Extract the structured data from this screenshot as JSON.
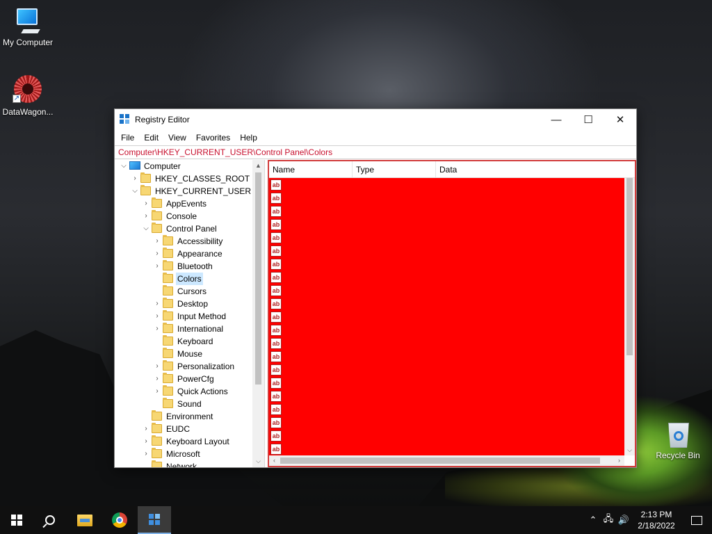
{
  "desktop": {
    "icons": [
      {
        "label": "My Computer"
      },
      {
        "label": "DataWagon..."
      },
      {
        "label": "Recycle Bin"
      }
    ]
  },
  "window": {
    "title": "Registry Editor",
    "controls": {
      "minimize": "—",
      "maximize": "☐",
      "close": "✕"
    },
    "menu": [
      "File",
      "Edit",
      "View",
      "Favorites",
      "Help"
    ],
    "address": "Computer\\HKEY_CURRENT_USER\\Control Panel\\Colors",
    "tree": [
      {
        "label": "Computer",
        "expander": "⌵"
      },
      {
        "label": "HKEY_CLASSES_ROOT",
        "expander": "›"
      },
      {
        "label": "HKEY_CURRENT_USER",
        "expander": "⌵"
      },
      {
        "label": "AppEvents",
        "expander": "›"
      },
      {
        "label": "Console",
        "expander": "›"
      },
      {
        "label": "Control Panel",
        "expander": "⌵"
      },
      {
        "label": "Accessibility",
        "expander": "›"
      },
      {
        "label": "Appearance",
        "expander": "›"
      },
      {
        "label": "Bluetooth",
        "expander": "›"
      },
      {
        "label": "Colors",
        "expander": ""
      },
      {
        "label": "Cursors",
        "expander": ""
      },
      {
        "label": "Desktop",
        "expander": "›"
      },
      {
        "label": "Input Method",
        "expander": "›"
      },
      {
        "label": "International",
        "expander": "›"
      },
      {
        "label": "Keyboard",
        "expander": ""
      },
      {
        "label": "Mouse",
        "expander": ""
      },
      {
        "label": "Personalization",
        "expander": "›"
      },
      {
        "label": "PowerCfg",
        "expander": "›"
      },
      {
        "label": "Quick Actions",
        "expander": "›"
      },
      {
        "label": "Sound",
        "expander": ""
      },
      {
        "label": "Environment",
        "expander": ""
      },
      {
        "label": "EUDC",
        "expander": "›"
      },
      {
        "label": "Keyboard Layout",
        "expander": "›"
      },
      {
        "label": "Microsoft",
        "expander": "›"
      },
      {
        "label": "Network",
        "expander": ""
      }
    ],
    "selected_key": "Colors",
    "columns": [
      "Name",
      "Type",
      "Data"
    ],
    "value_icon_text": "ab",
    "value_row_count": 21,
    "scroll_arrows": {
      "up": "▲",
      "down": "⌵",
      "left": "‹",
      "right": "›"
    }
  },
  "taskbar": {
    "clock_time": "2:13 PM",
    "clock_date": "2/18/2022",
    "tray_icons": {
      "chevron": "⌃",
      "network": "🖧",
      "volume": "🔊"
    }
  },
  "colors": {
    "accent_red": "#ff0000",
    "address_text": "#c8102e",
    "selection": "#cce8ff"
  }
}
